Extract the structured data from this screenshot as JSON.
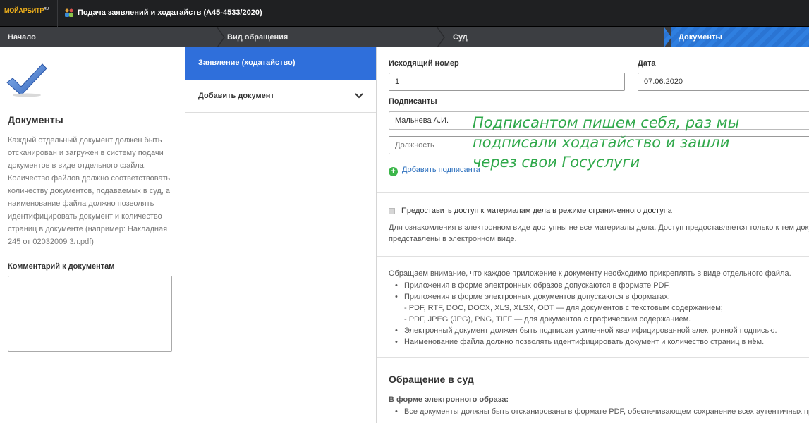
{
  "header": {
    "logo": {
      "part1": "МОЙ",
      "part2": "АРБИТР",
      "part3": "RU"
    },
    "title": "Подача заявлений и ходатайств  (А45-4533/2020)"
  },
  "steps": [
    {
      "label": "Начало"
    },
    {
      "label": "Вид обращения"
    },
    {
      "label": "Суд"
    },
    {
      "label": "Документы",
      "active": true
    }
  ],
  "left": {
    "heading": "Документы",
    "description": "Каждый отдельный документ должен быть отсканирован и загружен в систему подачи документов в виде отдельного файла. Количество файлов должно соответствовать количеству документов, подаваемых в суд, а наименование файла должно позволять идентифицировать документ и количество страниц в документе (например: Накладная 245 от 02032009 3л.pdf)",
    "comment_label": "Комментарий к документам",
    "comment_value": ""
  },
  "middle": {
    "active_item": "Заявление (ходатайство)",
    "add_document": "Добавить документ"
  },
  "form": {
    "outgoing_number_label": "Исходящий номер",
    "outgoing_number_value": "1",
    "date_label": "Дата",
    "date_value": "07.06.2020",
    "signers_label": "Подписанты",
    "signer_name": "Мальнева А.И.",
    "position_placeholder": "Должность",
    "add_signer": "Добавить подписанта",
    "restricted_access_label": "Предоставить доступ к материалам дела в режиме ограниченного доступа",
    "restricted_access_checked": true,
    "restricted_note_1": "Для ознакомления в электронном виде доступны не все материалы дела. Доступ предоставляется только к тем докум",
    "restricted_note_2": "представлены в электронном виде."
  },
  "notice": {
    "intro": "Обращаем внимание, что каждое приложение к документу необходимо прикреплять в виде отдельного файла.",
    "items": [
      "Приложения в форме электронных образов допускаются в формате PDF.",
      "Приложения в форме электронных документов допускаются в форматах:",
      "- PDF, RTF, DOC, DOCX, XLS, XLSX, ODT — для документов с текстовым содержанием;",
      "- PDF, JPEG (JPG), PNG, TIFF — для документов с графическим содержанием.",
      "Электронный документ должен быть подписан усиленной квалифицированной электронной подписью.",
      "Наименование файла должно позволять идентифицировать документ и количество страниц в нём."
    ]
  },
  "court": {
    "heading": "Обращение в суд",
    "subheading": "В форме электронного образа:",
    "item1": "Все документы должны быть отсканированы в формате PDF, обеспечивающем сохранение всех аутентичных при"
  },
  "annotation": {
    "line1": "Подписантом пишем себя, раз мы",
    "line2": "подписали ходатайство и зашли",
    "line3": "через свои Госуслуги",
    "color": "#2fa84a"
  }
}
